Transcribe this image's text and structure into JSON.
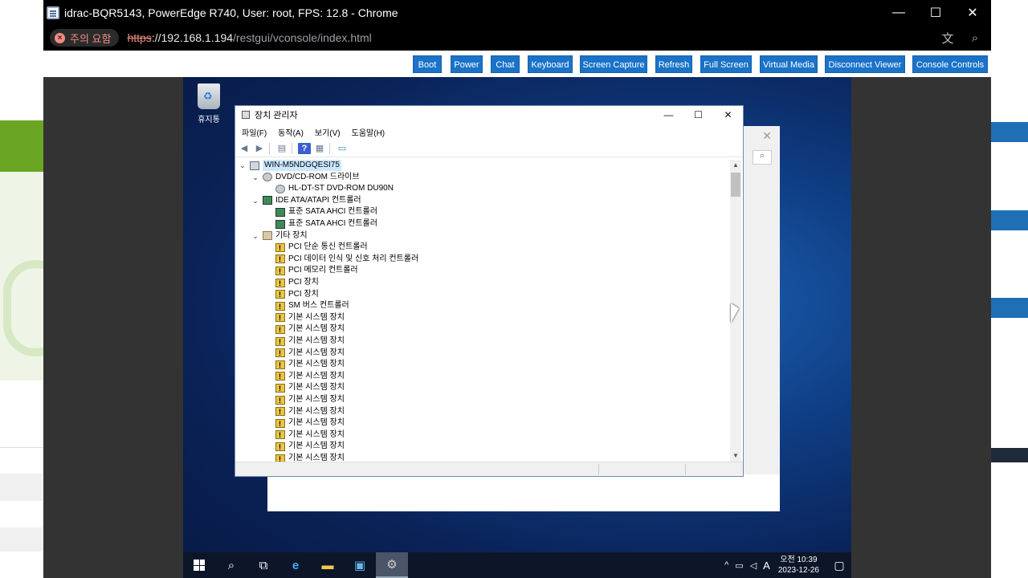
{
  "browser": {
    "window_title": "idrac-BQR5143, PowerEdge R740, User: root, FPS: 12.8 - Chrome",
    "security_chip": "주의 요함",
    "url_scheme": "https",
    "url_host": "://192.168.1.194",
    "url_path": "/restgui/vconsole/index.html",
    "minimize": "—",
    "maximize": "☐",
    "close": "✕",
    "translate_icon": "文",
    "zoom_icon": "⌕"
  },
  "toolbar": {
    "buttons": [
      {
        "label": "Boot",
        "key": "boot"
      },
      {
        "label": "Power",
        "key": "power"
      },
      {
        "label": "Chat",
        "key": "chat"
      },
      {
        "label": "Keyboard",
        "key": "keyboard"
      },
      {
        "label": "Screen Capture",
        "key": "screen-capture"
      },
      {
        "label": "Refresh",
        "key": "refresh"
      },
      {
        "label": "Full Screen",
        "key": "full-screen"
      },
      {
        "label": "Virtual Media",
        "key": "virtual-media"
      },
      {
        "label": "Disconnect Viewer",
        "key": "disconnect-viewer"
      },
      {
        "label": "Console Controls",
        "key": "console-controls"
      }
    ]
  },
  "desktop": {
    "recycle_bin_label": "휴지통"
  },
  "device_manager": {
    "title": "장치 관리자",
    "menu": [
      "파일(F)",
      "동작(A)",
      "보기(V)",
      "도움말(H)"
    ],
    "tree": [
      {
        "label": "WIN-M5NDGQESI75",
        "level": 0,
        "expand": "v",
        "icon": "pc",
        "selected": true
      },
      {
        "label": "DVD/CD-ROM 드라이브",
        "level": 1,
        "expand": "v",
        "icon": "dvd"
      },
      {
        "label": "HL-DT-ST DVD-ROM DU90N",
        "level": 2,
        "expand": "",
        "icon": "dvd"
      },
      {
        "label": "IDE ATA/ATAPI 컨트롤러",
        "level": 1,
        "expand": "v",
        "icon": "ide"
      },
      {
        "label": "표준 SATA AHCI 컨트롤러",
        "level": 2,
        "expand": "",
        "icon": "ide"
      },
      {
        "label": "표준 SATA AHCI 컨트롤러",
        "level": 2,
        "expand": "",
        "icon": "ide"
      },
      {
        "label": "기타 장치",
        "level": 1,
        "expand": "v",
        "icon": "other"
      },
      {
        "label": "PCI 단순 통신 컨트롤러",
        "level": 2,
        "expand": "",
        "icon": "warn"
      },
      {
        "label": "PCI 데이터 인식 및 신호 처리 컨트롤러",
        "level": 2,
        "expand": "",
        "icon": "warn"
      },
      {
        "label": "PCI 메모리 컨트롤러",
        "level": 2,
        "expand": "",
        "icon": "warn"
      },
      {
        "label": "PCI 장치",
        "level": 2,
        "expand": "",
        "icon": "warn"
      },
      {
        "label": "PCI 장치",
        "level": 2,
        "expand": "",
        "icon": "warn"
      },
      {
        "label": "SM 버스 컨트롤러",
        "level": 2,
        "expand": "",
        "icon": "warn"
      },
      {
        "label": "기본 시스템 장치",
        "level": 2,
        "expand": "",
        "icon": "warn"
      },
      {
        "label": "기본 시스템 장치",
        "level": 2,
        "expand": "",
        "icon": "warn"
      },
      {
        "label": "기본 시스템 장치",
        "level": 2,
        "expand": "",
        "icon": "warn"
      },
      {
        "label": "기본 시스템 장치",
        "level": 2,
        "expand": "",
        "icon": "warn"
      },
      {
        "label": "기본 시스템 장치",
        "level": 2,
        "expand": "",
        "icon": "warn"
      },
      {
        "label": "기본 시스템 장치",
        "level": 2,
        "expand": "",
        "icon": "warn"
      },
      {
        "label": "기본 시스템 장치",
        "level": 2,
        "expand": "",
        "icon": "warn"
      },
      {
        "label": "기본 시스템 장치",
        "level": 2,
        "expand": "",
        "icon": "warn"
      },
      {
        "label": "기본 시스템 장치",
        "level": 2,
        "expand": "",
        "icon": "warn"
      },
      {
        "label": "기본 시스템 장치",
        "level": 2,
        "expand": "",
        "icon": "warn"
      },
      {
        "label": "기본 시스템 장치",
        "level": 2,
        "expand": "",
        "icon": "warn"
      },
      {
        "label": "기본 시스템 장치",
        "level": 2,
        "expand": "",
        "icon": "warn"
      },
      {
        "label": "기본 시스템 장치",
        "level": 2,
        "expand": "",
        "icon": "warn"
      }
    ]
  },
  "taskbar": {
    "clock_time": "오전 10:39",
    "clock_date": "2023-12-26",
    "ime": "A"
  }
}
